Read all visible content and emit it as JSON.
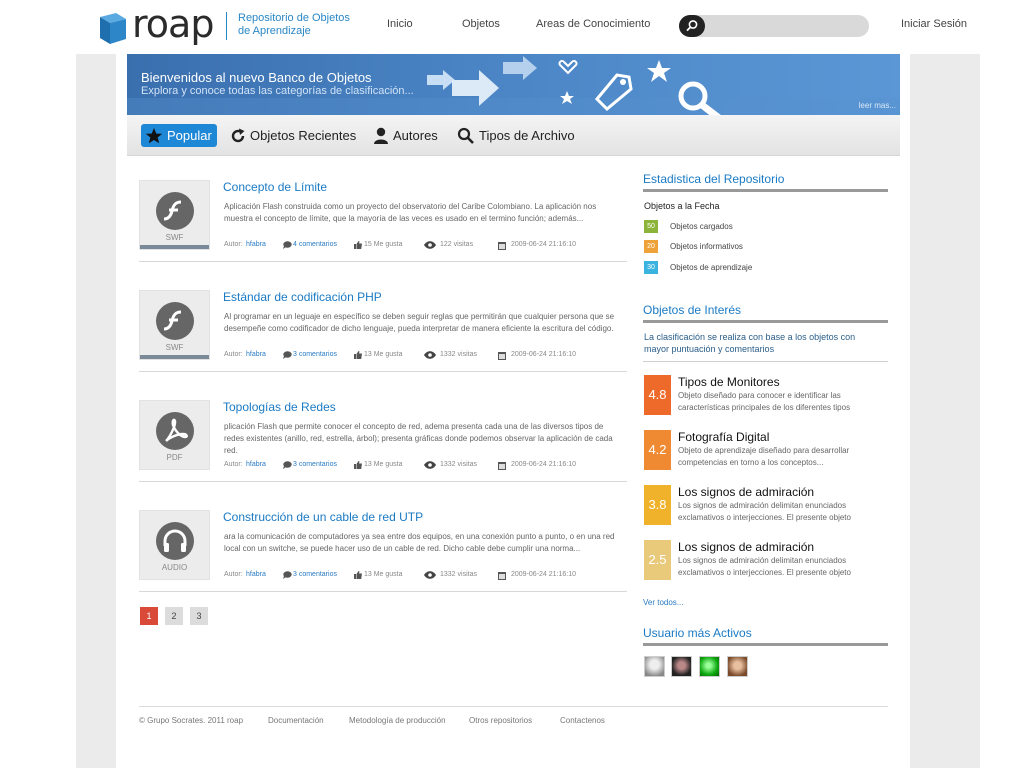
{
  "header": {
    "logo_text": "roap",
    "logo_subtitle_line1": "Repositorio de Objetos",
    "logo_subtitle_line2": "de Aprendizaje",
    "nav": [
      "Inicio",
      "Objetos",
      "Areas de Conocimiento"
    ],
    "search_placeholder": "",
    "login": "Iniciar Sesión"
  },
  "banner": {
    "title": "Bienvenidos al nuevo Banco de Objetos",
    "subtitle": "Explora y conoce todas las categorías de clasificación...",
    "more": "leer mas..."
  },
  "tabs": [
    {
      "label": "Popular",
      "icon": "star-icon"
    },
    {
      "label": "Objetos Recientes",
      "icon": "refresh-icon"
    },
    {
      "label": "Autores",
      "icon": "user-icon"
    },
    {
      "label": "Tipos de Archivo",
      "icon": "search-icon"
    }
  ],
  "items": [
    {
      "title": "Concepto de Límite",
      "type": "SWF",
      "desc": "Aplicación Flash construida como un proyecto del observatorio del Caribe Colombiano. La aplicación nos muestra el concepto de límite, que la mayoría de las veces es usado en el termino función; además...",
      "author_label": "Autor:",
      "author": "hfabra",
      "comments": "4 comentarios",
      "likes": "15 Me gusta",
      "visits": "122 visitas",
      "date": "2009-06-24 21:16:10"
    },
    {
      "title": "Estándar de codificación PHP",
      "type": "SWF",
      "desc": "Al programar en un leguaje en específico se deben seguir reglas que permitirán que cualquier persona que se desempeñe como codificador de dicho lenguaje, pueda interpretar de manera eficiente la escritura del código.",
      "author_label": "Autor:",
      "author": "hfabra",
      "comments": "3 comentarios",
      "likes": "13 Me gusta",
      "visits": "1332 visitas",
      "date": "2009-06-24 21:16:10"
    },
    {
      "title": "Topologías de Redes",
      "type": "PDF",
      "desc": "plicación Flash que permite conocer el concepto de red, adema presenta cada una de las diversos tipos de redes existentes (anillo, red, estrella, árbol); presenta gráficas donde podemos observar la aplicación de cada red.",
      "author_label": "Autor:",
      "author": "hfabra",
      "comments": "3 comentarios",
      "likes": "13 Me gusta",
      "visits": "1332 visitas",
      "date": "2009-06-24 21:16:10"
    },
    {
      "title": "Construcción de un cable de red UTP",
      "type": "AUDIO",
      "desc": "ara la comunicación de computadores ya sea entre dos equipos, en una conexión punto a punto, o en una red local con un switche, se puede hacer uso de un cable de red. Dicho cable debe cumplir una norma...",
      "author_label": "Autor:",
      "author": "hfabra",
      "comments": "3 comentarios",
      "likes": "13 Me gusta",
      "visits": "1332 visitas",
      "date": "2009-06-24 21:16:10"
    }
  ],
  "pagination": [
    "1",
    "2",
    "3"
  ],
  "sidebar": {
    "stats": {
      "heading": "Estadistica del Repositorio",
      "subheading": "Objetos a la Fecha",
      "rows": [
        {
          "count": "50",
          "label": "Objetos cargados",
          "color": "#8db43a"
        },
        {
          "count": "20",
          "label": "Objetos informativos",
          "color": "#f0a23a"
        },
        {
          "count": "30",
          "label": "Objetos de aprendizaje",
          "color": "#3ab3e0"
        }
      ]
    },
    "interest": {
      "heading": "Objetos de Interés",
      "desc": "La clasificación se realiza con base a los objetos con mayor puntuación y comentarios",
      "items": [
        {
          "score": "4.8",
          "title": "Tipos de Monitores",
          "desc": "Objeto diseñado para conocer e identificar las características principales de los diferentes tipos",
          "color": "#ee6a2a"
        },
        {
          "score": "4.2",
          "title": "Fotografía Digital",
          "desc": "Objeto de aprendizaje diseñado para desarrollar competencias en torno a los conceptos...",
          "color": "#f08a32"
        },
        {
          "score": "3.8",
          "title": "Los signos de admiración",
          "desc": "Los signos de admiración delimitan enunciados exclamativos o interjecciones. El presente objeto",
          "color": "#f0b22a"
        },
        {
          "score": "2.5",
          "title": "Los signos de admiración",
          "desc": "Los signos de admiración delimitan enunciados exclamativos o interjecciones. El presente objeto",
          "color": "#e9c97a"
        }
      ],
      "see_all": "Ver todos..."
    },
    "users": {
      "heading": "Usuario más Activos"
    }
  },
  "footer": {
    "copyright": "© Grupo Socrates. 2011 roap",
    "links": [
      "Documentación",
      "Metodología de producción",
      "Otros repositorios",
      "Contactenos"
    ]
  }
}
